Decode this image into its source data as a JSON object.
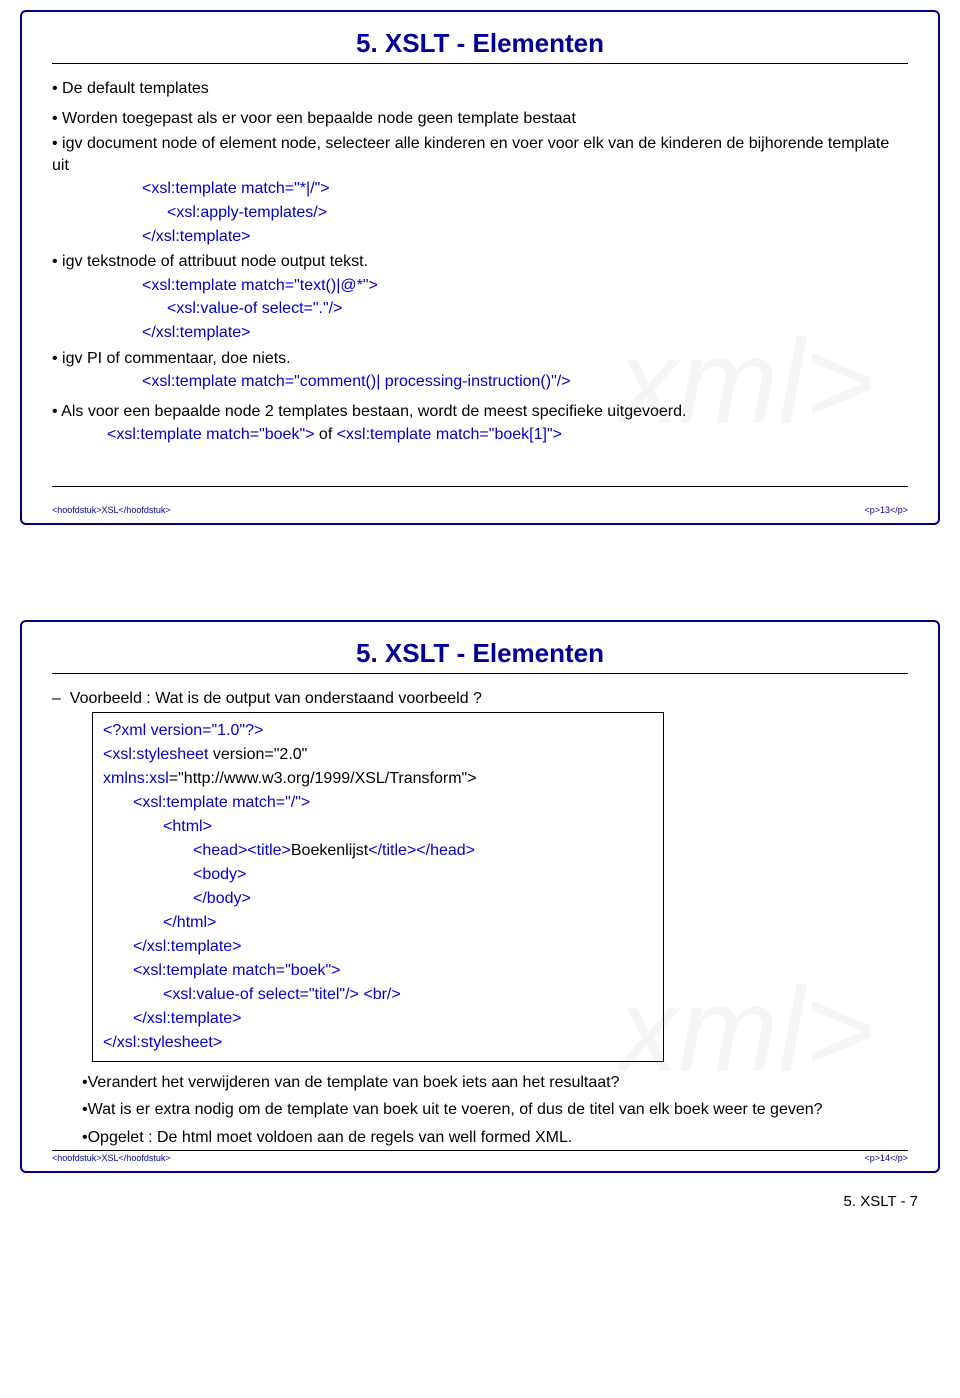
{
  "slide1": {
    "title": "5. XSLT - Elementen",
    "b1_1": "De default templates",
    "b2_1": "Worden toegepast als er voor een bepaalde node geen template bestaat",
    "b3_1": "igv document node of element node, selecteer alle kinderen en voer voor elk van de kinderen de bijhorende template uit",
    "c1_1": "<xsl:template match=\"*|/\">",
    "c1_2": "<xsl:apply-templates/>",
    "c1_3": "</xsl:template>",
    "b3_2": "igv tekstnode of attribuut node output tekst.",
    "c2_1": "<xsl:template match=\"text()|@*\">",
    "c2_2": "<xsl:value-of select=\".\"/>",
    "c2_3": "</xsl:template>",
    "b3_3": "igv PI of commentaar, doe niets.",
    "c3_1": "<xsl:template match=\"comment()| processing-instruction()\"/>",
    "b2_2a": "Als voor een bepaalde node 2 templates bestaan, wordt de meest specifieke uitgevoerd.",
    "c4_pre": "<xsl:template match=\"boek\">",
    "c4_mid": " of ",
    "c4_post": "<xsl:template match=\"boek[1]\">",
    "footer_left": "<hoofdstuk>XSL</hoofdstuk>",
    "footer_right": "<p>13</p>"
  },
  "slide2": {
    "title": "5. XSLT - Elementen",
    "b2_1": "Voorbeeld : Wat is de output van onderstaand voorbeeld ?",
    "code": {
      "l1": "<?xml version=\"1.0\"?>",
      "l2a": "<xsl:stylesheet ",
      "l2b": "version=\"2.0\"",
      "l3a": "xmlns:xsl",
      "l3b": "=\"http://www.w3.org/1999/XSL/Transform\">",
      "l4": "<xsl:template match=\"/\">",
      "l5a": "<html>",
      "l6a": "<head><title>",
      "l6b": "Boekenlijst",
      "l6c": "</title></head>",
      "l7": "<body>",
      "l8": "</body>",
      "l9": "</html>",
      "l10": "</xsl:template>",
      "l11": "<xsl:template match=\"boek\">",
      "l12a": "<xsl:value-of select=\"titel\"/>",
      "l12b": " <br/>",
      "l13": "</xsl:template>",
      "l14": "</xsl:stylesheet>"
    },
    "q1": "Verandert het verwijderen van de template van boek iets aan het resultaat?",
    "q2": "Wat is er extra nodig om de template van boek uit te voeren, of dus de titel van elk boek weer te geven?",
    "q3": "Opgelet : De html moet voldoen aan de regels van well formed XML.",
    "footer_left": "<hoofdstuk>XSL</hoofdstuk>",
    "footer_right": "<p>14</p>"
  },
  "pagefooter": "5. XSLT - 7"
}
